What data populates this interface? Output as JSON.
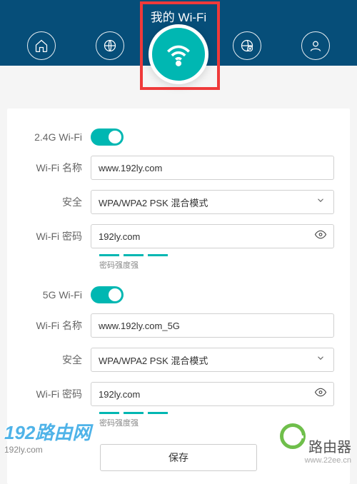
{
  "header": {
    "title": "我的 Wi-Fi"
  },
  "nav": {
    "items": [
      "home",
      "globe",
      "wifi",
      "globe-settings",
      "user"
    ]
  },
  "wifi24": {
    "section_label": "2.4G Wi-Fi",
    "toggle": true,
    "name_label": "Wi-Fi 名称",
    "name_value": "www.192ly.com",
    "security_label": "安全",
    "security_value": "WPA/WPA2 PSK 混合模式",
    "password_label": "Wi-Fi 密码",
    "password_value": "192ly.com",
    "strength_label": "密码强度强"
  },
  "wifi5": {
    "section_label": "5G Wi-Fi",
    "toggle": true,
    "name_label": "Wi-Fi 名称",
    "name_value": "www.192ly.com_5G",
    "security_label": "安全",
    "security_value": "WPA/WPA2 PSK 混合模式",
    "password_label": "Wi-Fi 密码",
    "password_value": "192ly.com",
    "strength_label": "密码强度强"
  },
  "actions": {
    "save": "保存"
  },
  "watermarks": {
    "left_main": "192路由网",
    "left_sub": "192ly.com",
    "right_text": "路由器",
    "right_url": "www.22ee.cn"
  }
}
